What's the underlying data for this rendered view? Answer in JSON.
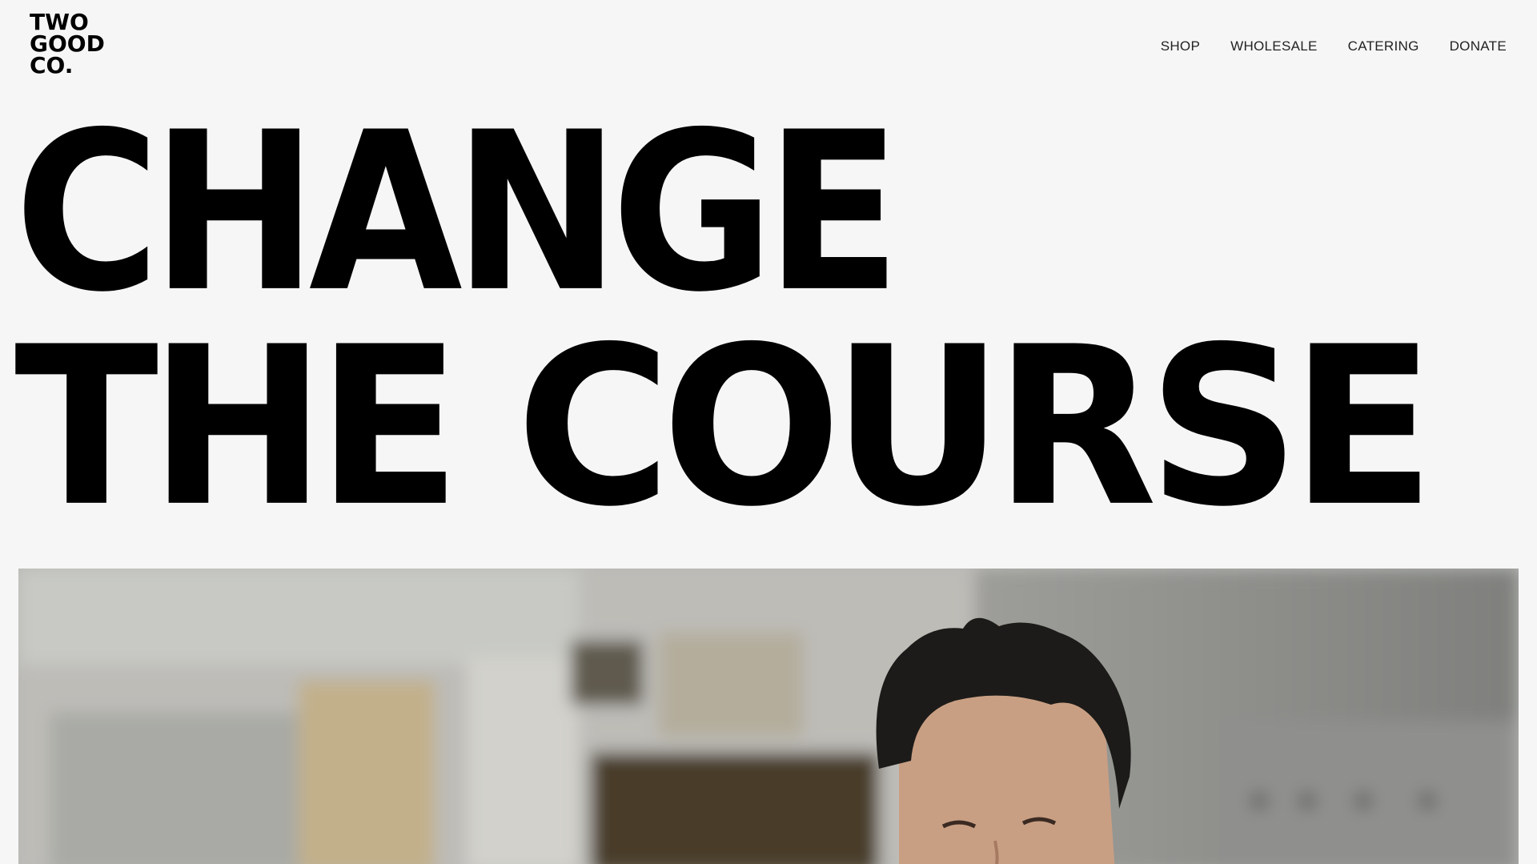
{
  "logo": {
    "line1": "TWO",
    "line2": "GOOD",
    "line3": "CO."
  },
  "nav": {
    "items": [
      {
        "label": "SHOP"
      },
      {
        "label": "WHOLESALE"
      },
      {
        "label": "CATERING"
      },
      {
        "label": "DONATE"
      }
    ]
  },
  "hero": {
    "line1": "CHANGE",
    "line2": "THE COURSE"
  },
  "colors": {
    "background": "#f6f6f6",
    "text": "#000000",
    "nav_text": "#222222"
  }
}
